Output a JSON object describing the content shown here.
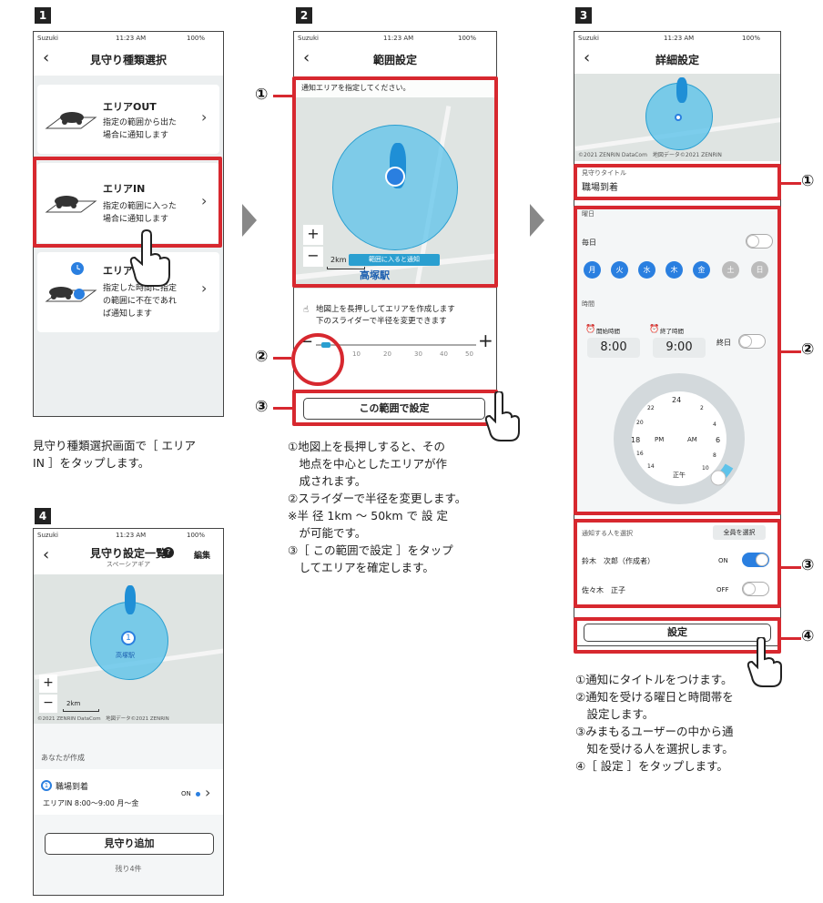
{
  "steps": [
    "1",
    "2",
    "3",
    "4"
  ],
  "status": {
    "carrier": "Suzuki",
    "time": "11:23 AM",
    "battery": "100%"
  },
  "s1": {
    "title": "見守り種類選択",
    "options": [
      {
        "name": "エリアOUT",
        "line1": "指定の範囲から出た",
        "line2": "場合に通知します"
      },
      {
        "name": "エリアIN",
        "line1": "指定の範囲に入った",
        "line2": "場合に通知します"
      },
      {
        "name": "エリア不",
        "line1": "指定した時間に指定",
        "line2": "の範囲に不在であれ",
        "line3": "ば通知します"
      }
    ],
    "desc1": "見守り種類選択画面で［ エリア",
    "desc2": "IN ］をタップします。"
  },
  "s2": {
    "title": "範囲設定",
    "hint": "通知エリアを指定してください。",
    "map_label": "範囲に入ると通知",
    "station": "高塚駅",
    "scale": "2km",
    "zoom_in": "+",
    "zoom_out": "−",
    "help1": "地図上を長押ししてエリアを作成します",
    "help2": "下のスライダーで半径を変更できます",
    "ticks": [
      "10",
      "20",
      "30",
      "40",
      "50"
    ],
    "minus": "−",
    "plus": "+",
    "button": "この範囲で設定",
    "markers": [
      "①",
      "②",
      "③"
    ],
    "desc": [
      "①地図上を長押しすると、その",
      "　地点を中心としたエリアが作",
      "　成されます。",
      "②スライダーで半径を変更します。",
      "※半 径 1km 〜 50km で 設 定",
      "　が可能です。",
      "③［ この範囲で設定 ］をタップ",
      "　してエリアを確定します。"
    ]
  },
  "s3": {
    "title": "詳細設定",
    "copyright": "©2021 ZENRIN DataCom　地図データ©2021 ZENRIN",
    "title_label": "見守りタイトル",
    "title_value": "職場到着",
    "dow_label": "曜日",
    "everyday": "毎日",
    "days": [
      "月",
      "火",
      "水",
      "木",
      "金",
      "土",
      "日"
    ],
    "time_label": "時間",
    "start_label": "開始時間",
    "end_label": "終了時間",
    "start": "8:00",
    "end": "9:00",
    "allday": "終日",
    "clock": [
      "24",
      "2",
      "4",
      "6",
      "8",
      "10",
      "正午",
      "14",
      "16",
      "18",
      "20",
      "22"
    ],
    "pm": "PM",
    "am": "AM",
    "notify_label": "通知する人を選択",
    "select_all": "全員を選択",
    "people": [
      {
        "name": "鈴木　次郎（作成者）",
        "state": "ON"
      },
      {
        "name": "佐々木　正子",
        "state": "OFF"
      }
    ],
    "button": "設定",
    "markers": [
      "①",
      "②",
      "③",
      "④"
    ],
    "desc": [
      "①通知にタイトルをつけます。",
      "②通知を受ける曜日と時間帯を",
      "　設定します。",
      "③みまもるユーザーの中から通",
      "　知を受ける人を選択します。",
      "④［ 設定 ］をタップします。"
    ]
  },
  "s4": {
    "title": "見守り設定一覧",
    "subtitle": "スペーシアギア",
    "edit": "編集",
    "zoom_in": "+",
    "zoom_out": "−",
    "scale": "2km",
    "station": "高塚駅",
    "copyright": "©2021 ZENRIN DataCom　地図データ©2021 ZENRIN",
    "section": "あなたが作成",
    "item_title": "職場到着",
    "item_sub": "エリアIN 8:00〜9:00 月〜金",
    "item_state": "ON",
    "button": "見守り追加",
    "remaining": "残り4件"
  },
  "colors": {
    "red": "#d7282f",
    "blue": "#2a7fe0",
    "circle": "#5ec3ea"
  }
}
